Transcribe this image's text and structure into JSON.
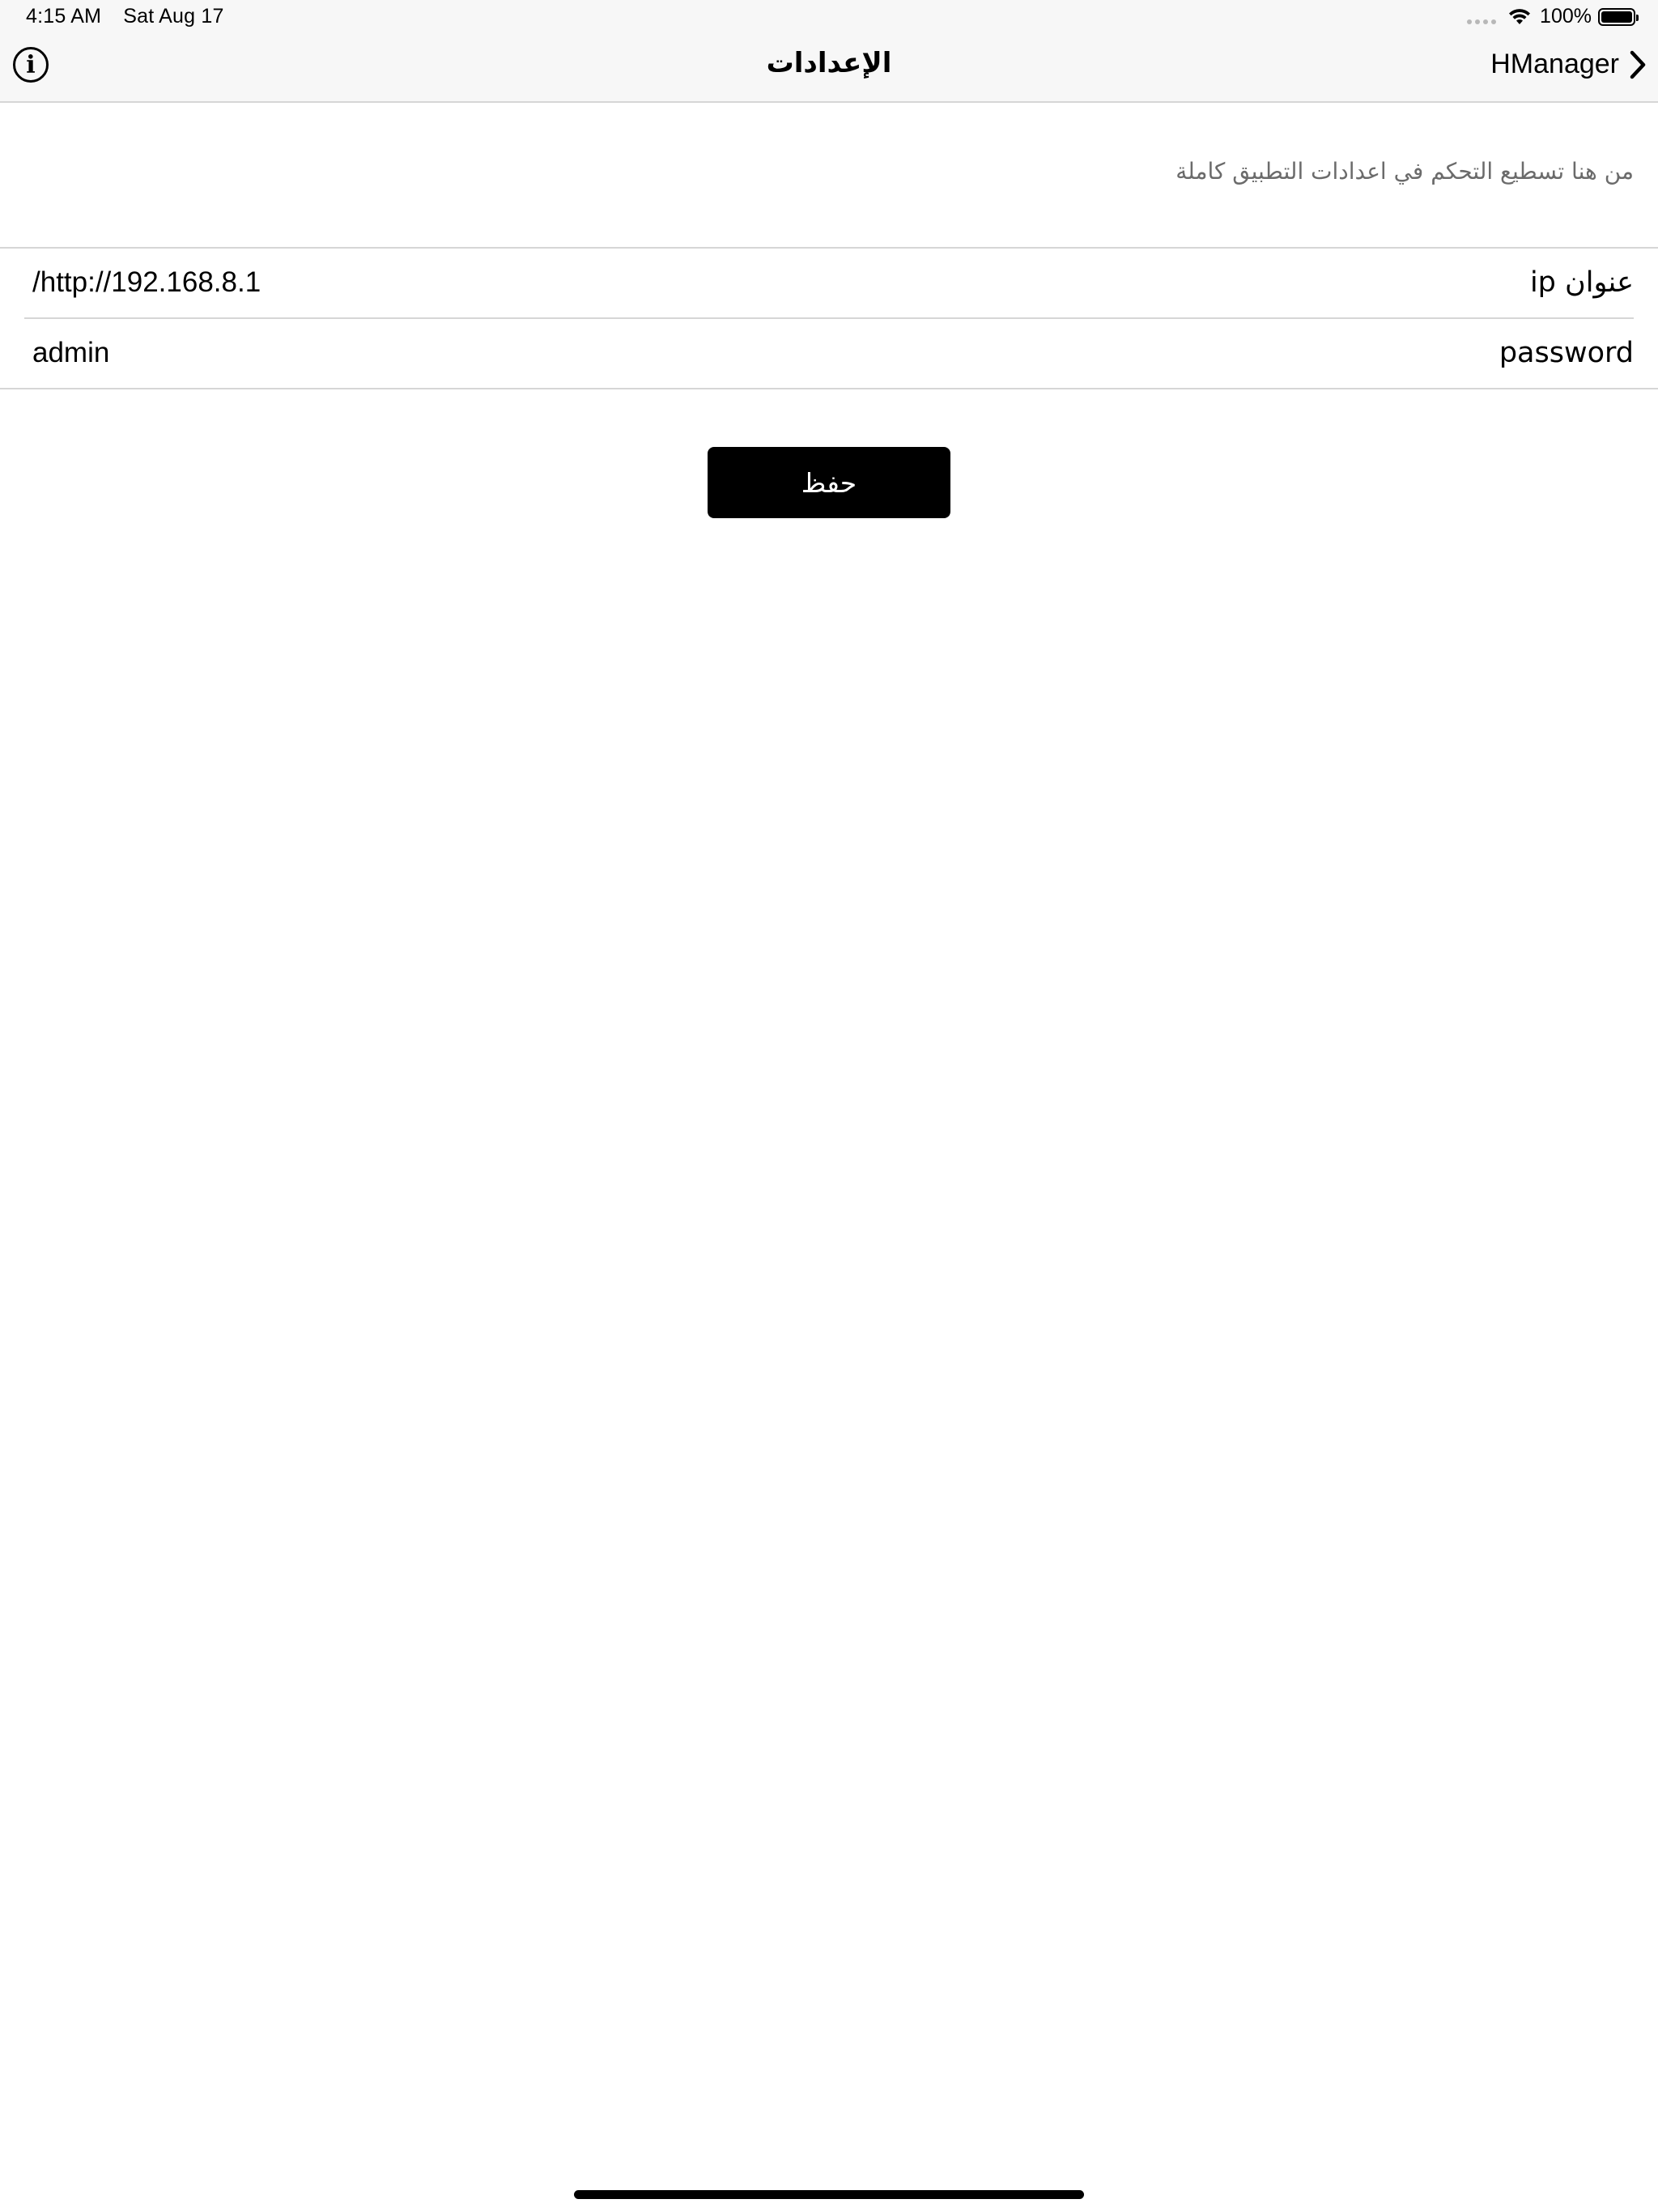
{
  "status_bar": {
    "time": "4:15 AM",
    "date": "Sat Aug 17",
    "battery": "100%"
  },
  "nav": {
    "title": "الإعدادات",
    "forward_label": "HManager"
  },
  "description": "من هنا تسطيع التحكم في اعدادات التطبيق كاملة",
  "form": {
    "ip": {
      "label": "عنوان ip",
      "value": "/http://192.168.8.1"
    },
    "password": {
      "label": "password",
      "value": "admin"
    }
  },
  "save_label": "حفظ"
}
